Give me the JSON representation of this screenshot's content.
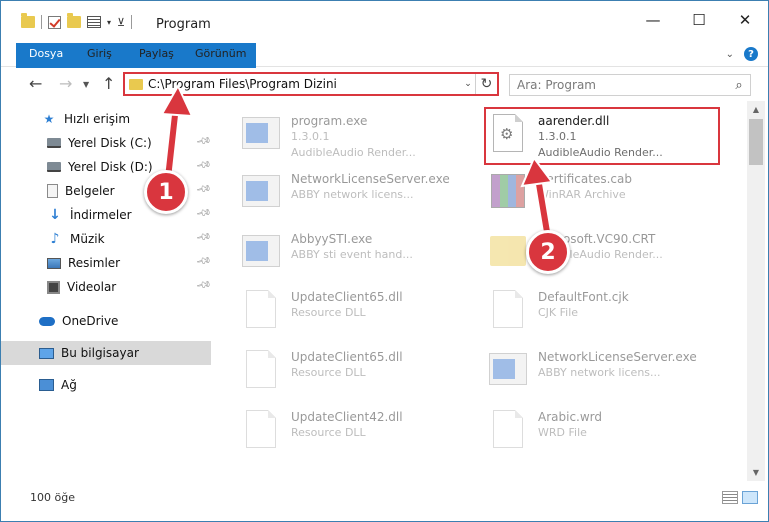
{
  "window": {
    "title": "Program",
    "controls": {
      "minimize": "—",
      "maximize": "☐",
      "close": "✕"
    }
  },
  "ribbon": {
    "tabs": [
      "Dosya",
      "Giriş",
      "Paylaş",
      "Görünüm"
    ],
    "help": "?"
  },
  "address": {
    "path": "C:\\Program Files\\Program Dizini",
    "search_placeholder": "Ara: Program"
  },
  "sidebar": {
    "items": [
      {
        "label": "Hızlı erişim",
        "icon": "star-icon"
      },
      {
        "label": "Yerel Disk (C:)",
        "icon": "disk-icon",
        "pinned": true
      },
      {
        "label": "Yerel Disk (D:)",
        "icon": "disk-icon",
        "pinned": true
      },
      {
        "label": "Belgeler",
        "icon": "documents-icon",
        "pinned": true
      },
      {
        "label": "İndirmeler",
        "icon": "download-icon",
        "pinned": true
      },
      {
        "label": "Müzik",
        "icon": "music-icon",
        "pinned": true
      },
      {
        "label": "Resimler",
        "icon": "pictures-icon",
        "pinned": true
      },
      {
        "label": "Videolar",
        "icon": "videos-icon",
        "pinned": true
      },
      {
        "label": "OneDrive",
        "icon": "onedrive-icon"
      },
      {
        "label": "Bu bilgisayar",
        "icon": "computer-icon",
        "selected": true
      },
      {
        "label": "Ağ",
        "icon": "network-icon"
      }
    ]
  },
  "files": [
    {
      "name": "program.exe",
      "line2": "1.3.0.1",
      "line3": "AudibleAudio Render..."
    },
    {
      "name": "aarender.dll",
      "line2": "1.3.0.1",
      "line3": "AudibleAudio Render..."
    },
    {
      "name": "NetworkLicenseServer.exe",
      "line2": "ABBY network licens..."
    },
    {
      "name": "Certificates.cab",
      "line2": "WinRAR Archive"
    },
    {
      "name": "AbbyySTI.exe",
      "line2": "ABBY sti event hand..."
    },
    {
      "name": "Microsoft.VC90.CRT",
      "line2": "AudibleAudio Render..."
    },
    {
      "name": "UpdateClient65.dll",
      "line2": "Resource DLL"
    },
    {
      "name": "DefaultFont.cjk",
      "line2": "CJK File"
    },
    {
      "name": "UpdateClient65.dll",
      "line2": "Resource DLL"
    },
    {
      "name": "NetworkLicenseServer.exe",
      "line2": "ABBY network licens..."
    },
    {
      "name": "UpdateClient42.dll",
      "line2": "Resource DLL"
    },
    {
      "name": "Arabic.wrd",
      "line2": "WRD File"
    }
  ],
  "status": {
    "count": "100 öğe"
  },
  "annotations": {
    "step1": "1",
    "step2": "2",
    "color": "#d9363e"
  }
}
